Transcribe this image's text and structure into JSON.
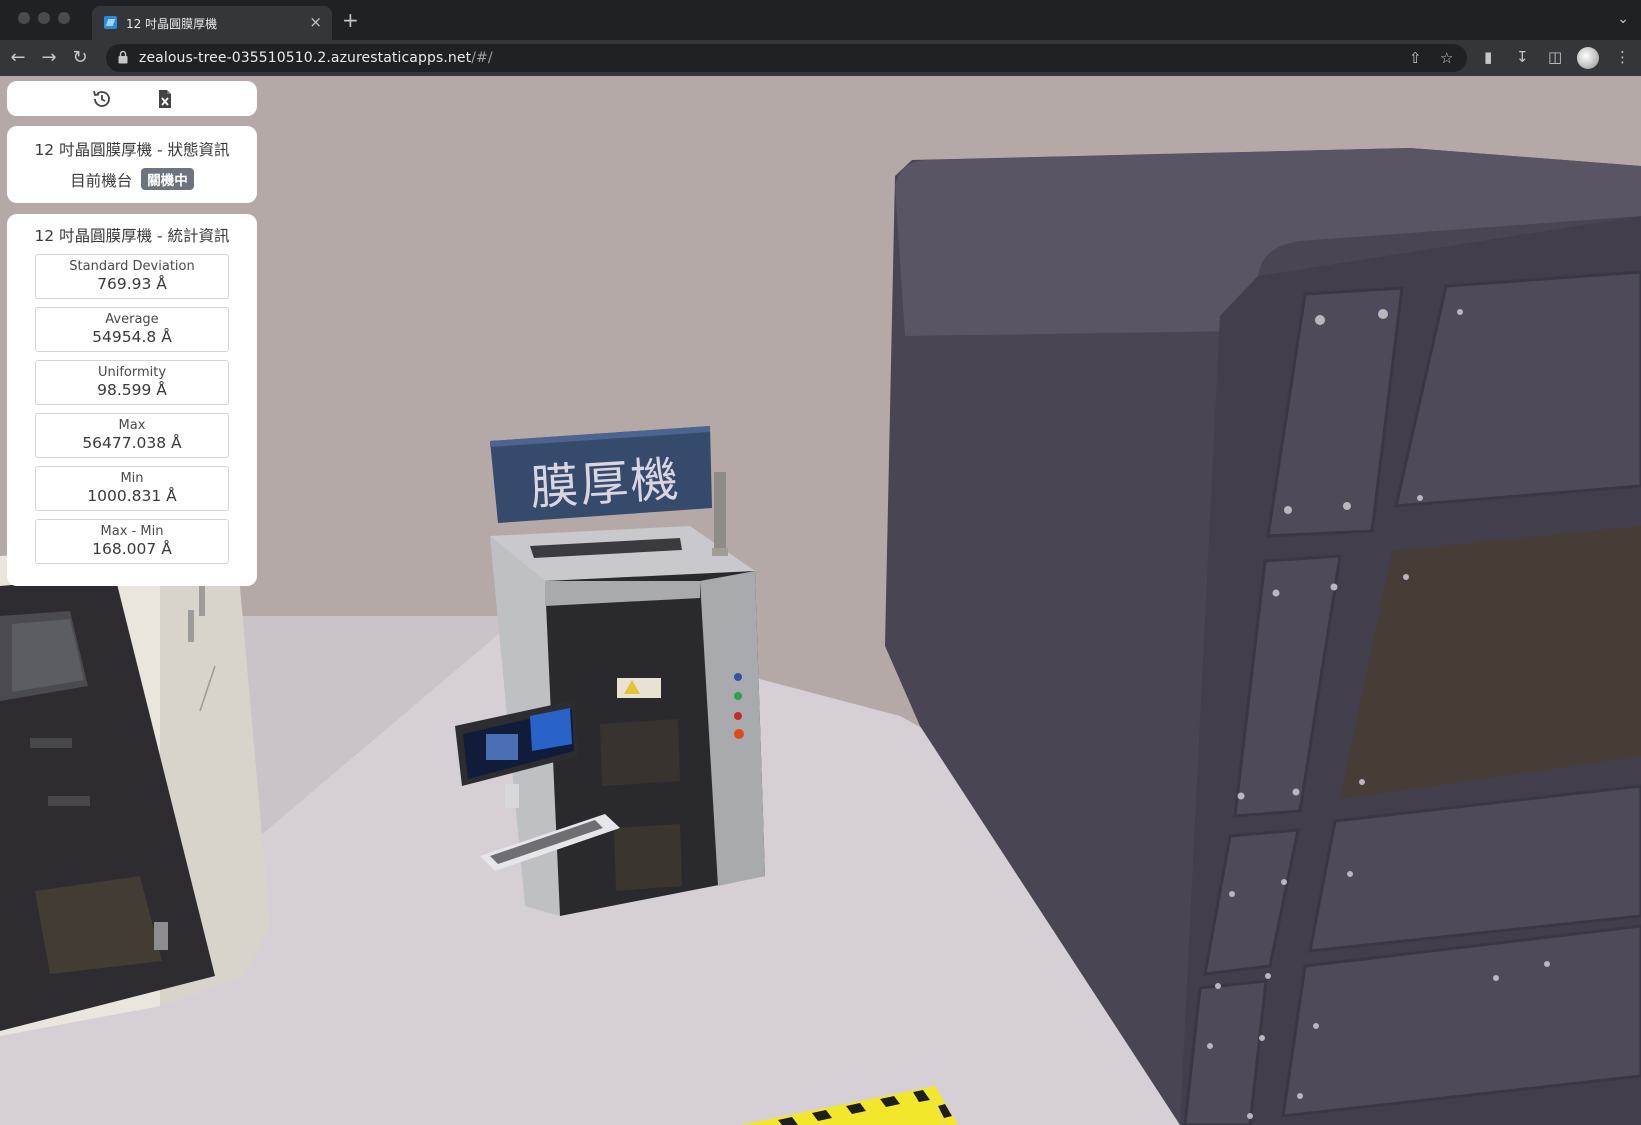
{
  "browser": {
    "tab_title": "12 吋晶圓膜厚機",
    "tab_close": "×",
    "new_tab": "+",
    "url_host": "zealous-tree-035510510.2.azurestaticapps.net",
    "url_path": "/#/"
  },
  "toolbar_panel": {
    "icons": [
      "history-icon",
      "excel-file-icon"
    ]
  },
  "status_panel": {
    "title": "12 吋晶圓膜厚機 - 狀態資訊",
    "current_label": "目前機台",
    "status": "關機中"
  },
  "stats_panel": {
    "title": "12 吋晶圓膜厚機 - 統計資訊",
    "stats": [
      {
        "label": "Standard Deviation",
        "value": "769.93 Å"
      },
      {
        "label": "Average",
        "value": "54954.8 Å"
      },
      {
        "label": "Uniformity",
        "value": "98.599 Å"
      },
      {
        "label": "Max",
        "value": "56477.038 Å"
      },
      {
        "label": "Min",
        "value": "1000.831 Å"
      },
      {
        "label": "Max - Min",
        "value": "168.007 Å"
      }
    ]
  },
  "scene": {
    "machine_sign": "膜厚機"
  },
  "colors": {
    "status_badge": "#6c757d",
    "wall": "#b6aaa9",
    "floor": "#d6d0d6",
    "large_machine": "#4a4654",
    "sign": "#364a6b"
  }
}
